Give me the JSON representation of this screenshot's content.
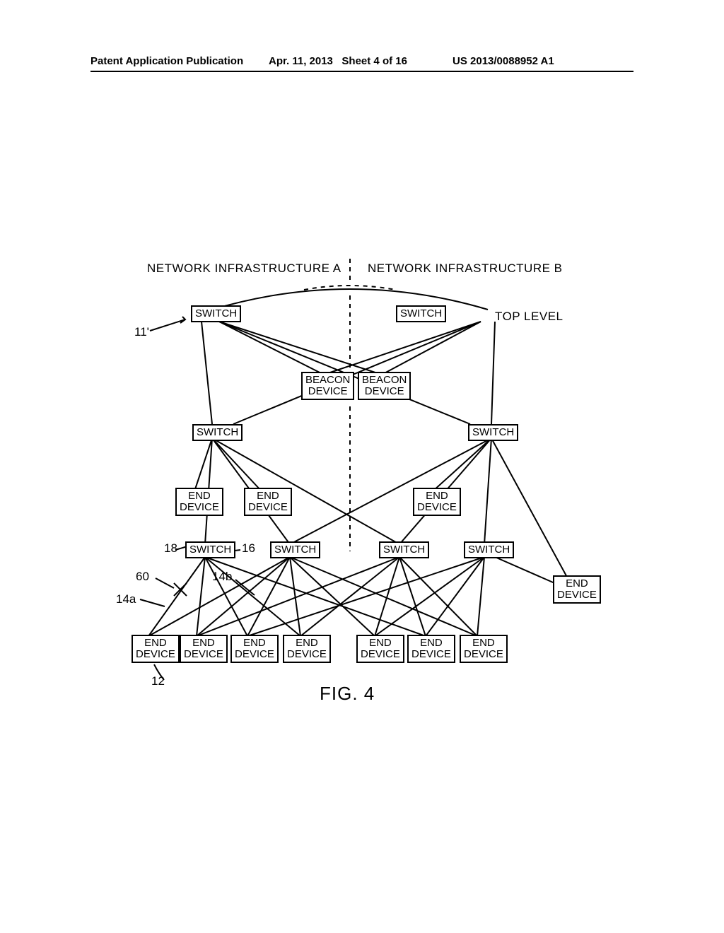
{
  "header": {
    "pub_type": "Patent Application Publication",
    "date": "Apr. 11, 2013",
    "sheet": "Sheet 4 of 16",
    "pub_no": "US 2013/0088952 A1"
  },
  "section_labels": {
    "net_a": "NETWORK INFRASTRUCTURE A",
    "net_b": "NETWORK INFRASTRUCTURE B",
    "top_level": "TOP LEVEL"
  },
  "nodes": {
    "switch_top_a": "SWITCH",
    "switch_top_b": "SWITCH",
    "beacon_a": "BEACON\nDEVICE",
    "beacon_b": "BEACON\nDEVICE",
    "switch_mid_a": "SWITCH",
    "switch_mid_b": "SWITCH",
    "end_mid_1": "END\nDEVICE",
    "end_mid_2": "END\nDEVICE",
    "end_mid_3": "END\nDEVICE",
    "switch_low_1": "SWITCH",
    "switch_low_2": "SWITCH",
    "switch_low_3": "SWITCH",
    "switch_low_4": "SWITCH",
    "end_right": "END\nDEVICE",
    "end_bot_1": "END\nDEVICE",
    "end_bot_2": "END\nDEVICE",
    "end_bot_3": "END\nDEVICE",
    "end_bot_4": "END\nDEVICE",
    "end_bot_5": "END\nDEVICE",
    "end_bot_6": "END\nDEVICE",
    "end_bot_7": "END\nDEVICE"
  },
  "refs": {
    "r11p": "11'",
    "r18": "18",
    "r16": "16",
    "r60": "60",
    "r14a": "14a",
    "r14b": "14b",
    "r12": "12"
  },
  "figure_caption": "FIG. 4"
}
